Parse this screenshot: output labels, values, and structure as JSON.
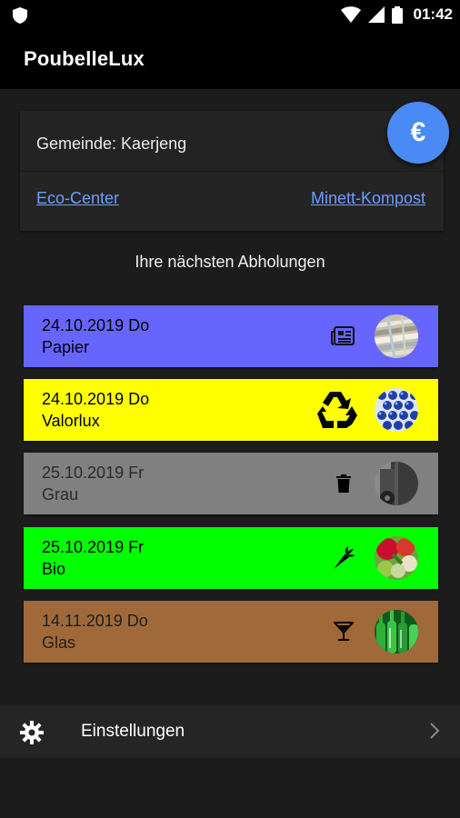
{
  "status_bar": {
    "time": "01:42"
  },
  "app": {
    "title": "PoubelleLux"
  },
  "info": {
    "gemeinde": "Gemeinde: Kaerjeng",
    "link_eco": "Eco-Center",
    "link_minett": "Minett-Kompost",
    "fab_symbol": "€"
  },
  "section_title": "Ihre nächsten Abholungen",
  "pickups": [
    {
      "date": "24.10.2019 Do",
      "type": "Papier",
      "color": "#6666ff",
      "text_color": "#000000",
      "icon": "newspaper-icon"
    },
    {
      "date": "24.10.2019 Do",
      "type": "Valorlux",
      "color": "#ffff00",
      "text_color": "#000000",
      "icon": "recycle-icon"
    },
    {
      "date": "25.10.2019 Fr",
      "type": "Grau",
      "color": "#808080",
      "text_color": "#2b2b2b",
      "icon": "trash-icon"
    },
    {
      "date": "25.10.2019 Fr",
      "type": "Bio",
      "color": "#00ff00",
      "text_color": "#000000",
      "icon": "carrot-icon"
    },
    {
      "date": "14.11.2019 Do",
      "type": "Glas",
      "color": "#a0693a",
      "text_color": "#1f1f1f",
      "icon": "cocktail-glass-icon"
    }
  ],
  "settings": {
    "label": "Einstellungen"
  }
}
